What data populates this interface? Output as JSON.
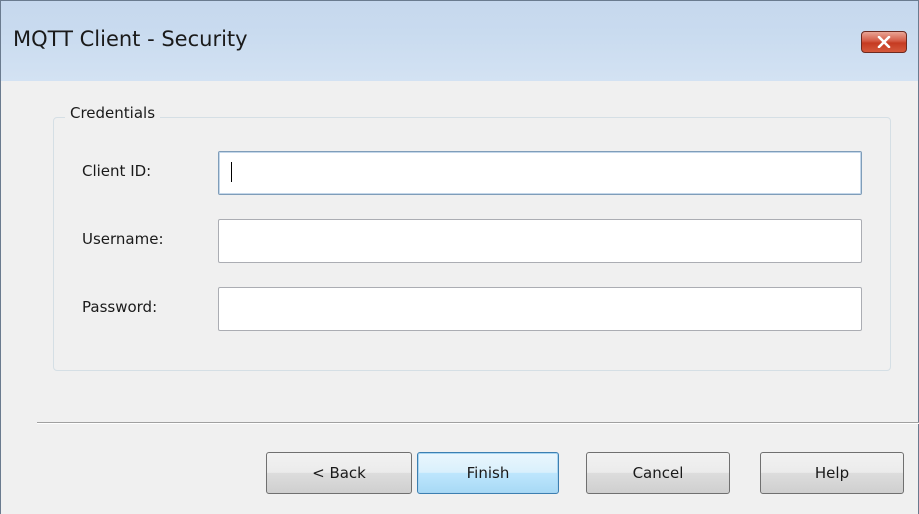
{
  "window": {
    "title": "MQTT Client - Security"
  },
  "credentials": {
    "legend": "Credentials",
    "fields": [
      {
        "label": "Client ID:",
        "value": "",
        "focused": true
      },
      {
        "label": "Username:",
        "value": ""
      },
      {
        "label": "Password:",
        "value": ""
      }
    ]
  },
  "buttons": {
    "back": "< Back",
    "finish": "Finish",
    "cancel": "Cancel",
    "help": "Help"
  },
  "icons": {
    "close": "close-icon"
  },
  "colors": {
    "titlebar": "#c9dbef",
    "close_button": "#c53b22",
    "dialog_background": "#f0f0f0",
    "default_button_border": "#3c7fb1"
  }
}
